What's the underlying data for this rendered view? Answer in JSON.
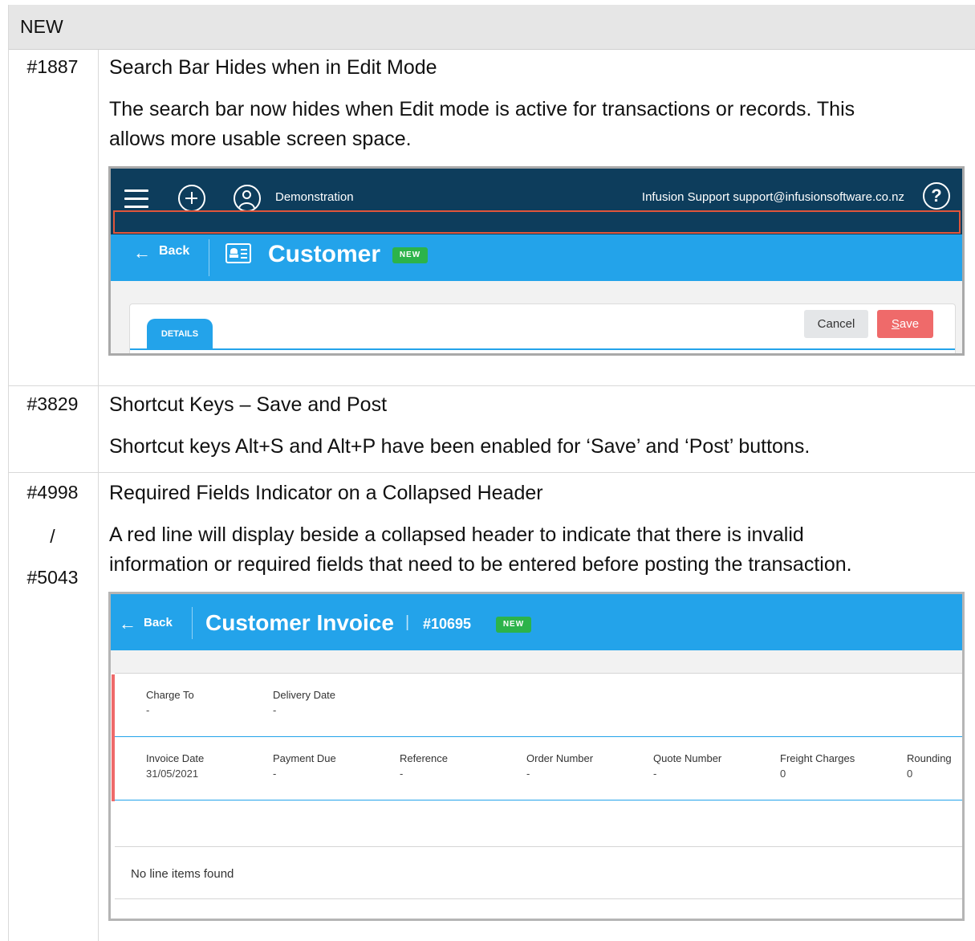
{
  "section": {
    "header": "NEW"
  },
  "items": [
    {
      "ticket": "#1887",
      "title": "Search Bar Hides when in Edit Mode",
      "description_lines": [
        "The search bar now hides when Edit mode is active for transactions or records. This",
        "allows more usable screen space."
      ]
    },
    {
      "ticket": "#3829",
      "title": "Shortcut Keys – Save and Post",
      "description_lines": [
        "Shortcut keys Alt+S and Alt+P have been enabled for ‘Save’ and ‘Post’ buttons."
      ]
    },
    {
      "ticket_lines": [
        "#4998",
        "/",
        "#5043"
      ],
      "title": "Required Fields Indicator on a Collapsed Header",
      "description_lines": [
        "A red line will display beside a collapsed header to indicate that there is invalid",
        "information or required fields that need to be entered before posting the transaction."
      ]
    }
  ],
  "screenshot1": {
    "org_name": "Demonstration",
    "support": "Infusion Support support@infusionsoftware.co.nz",
    "help_glyph": "?",
    "back_label": "Back",
    "page_title": "Customer",
    "badge": "NEW",
    "tab_label": "DETAILS",
    "cancel_label": "Cancel",
    "save_first_letter": "S",
    "save_rest": "ave",
    "highlight_color": "#e0553a",
    "topbar_color": "#0d3d5c",
    "accent_color": "#23a3ea"
  },
  "screenshot2": {
    "back_label": "Back",
    "page_title": "Customer Invoice",
    "separator": "|",
    "invoice_number": "#10695",
    "badge": "NEW",
    "row1": [
      {
        "label": "Charge To",
        "value": "-"
      },
      {
        "label": "Delivery Date",
        "value": "-"
      }
    ],
    "row2": [
      {
        "label": "Invoice Date",
        "value": "31/05/2021"
      },
      {
        "label": "Payment Due",
        "value": "-"
      },
      {
        "label": "Reference",
        "value": "-"
      },
      {
        "label": "Order Number",
        "value": "-"
      },
      {
        "label": "Quote Number",
        "value": "-"
      },
      {
        "label": "Freight Charges",
        "value": "0"
      },
      {
        "label": "Rounding",
        "value": "0"
      }
    ],
    "empty_message": "No line items found",
    "indicator_color": "#ef6a6a"
  }
}
